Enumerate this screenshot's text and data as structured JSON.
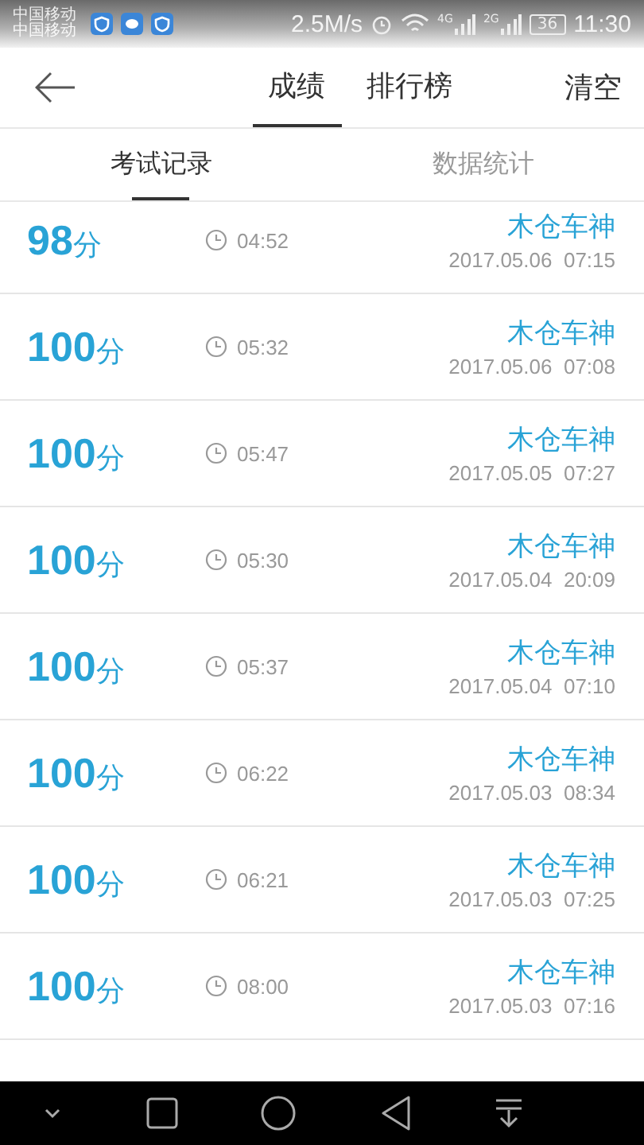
{
  "status_bar": {
    "carriers": [
      "中国移动",
      "中国移动"
    ],
    "speed": "2.5M/s",
    "network_labels": [
      "4G",
      "2G"
    ],
    "battery": "36",
    "time": "11:30"
  },
  "header": {
    "tabs": [
      {
        "label": "成绩",
        "selected": true
      },
      {
        "label": "排行榜",
        "selected": false
      }
    ],
    "action": "清空"
  },
  "subtabs": [
    {
      "label": "考试记录",
      "selected": true
    },
    {
      "label": "数据统计",
      "selected": false
    }
  ],
  "records": [
    {
      "score": "98",
      "unit": "分",
      "duration": "04:52",
      "name": "木仓车神",
      "datetime": "2017.05.06  07:15"
    },
    {
      "score": "100",
      "unit": "分",
      "duration": "05:32",
      "name": "木仓车神",
      "datetime": "2017.05.06  07:08"
    },
    {
      "score": "100",
      "unit": "分",
      "duration": "05:47",
      "name": "木仓车神",
      "datetime": "2017.05.05  07:27"
    },
    {
      "score": "100",
      "unit": "分",
      "duration": "05:30",
      "name": "木仓车神",
      "datetime": "2017.05.04  20:09"
    },
    {
      "score": "100",
      "unit": "分",
      "duration": "05:37",
      "name": "木仓车神",
      "datetime": "2017.05.04  07:10"
    },
    {
      "score": "100",
      "unit": "分",
      "duration": "06:22",
      "name": "木仓车神",
      "datetime": "2017.05.03  08:34"
    },
    {
      "score": "100",
      "unit": "分",
      "duration": "06:21",
      "name": "木仓车神",
      "datetime": "2017.05.03  07:25"
    },
    {
      "score": "100",
      "unit": "分",
      "duration": "08:00",
      "name": "木仓车神",
      "datetime": "2017.05.03  07:16"
    }
  ]
}
